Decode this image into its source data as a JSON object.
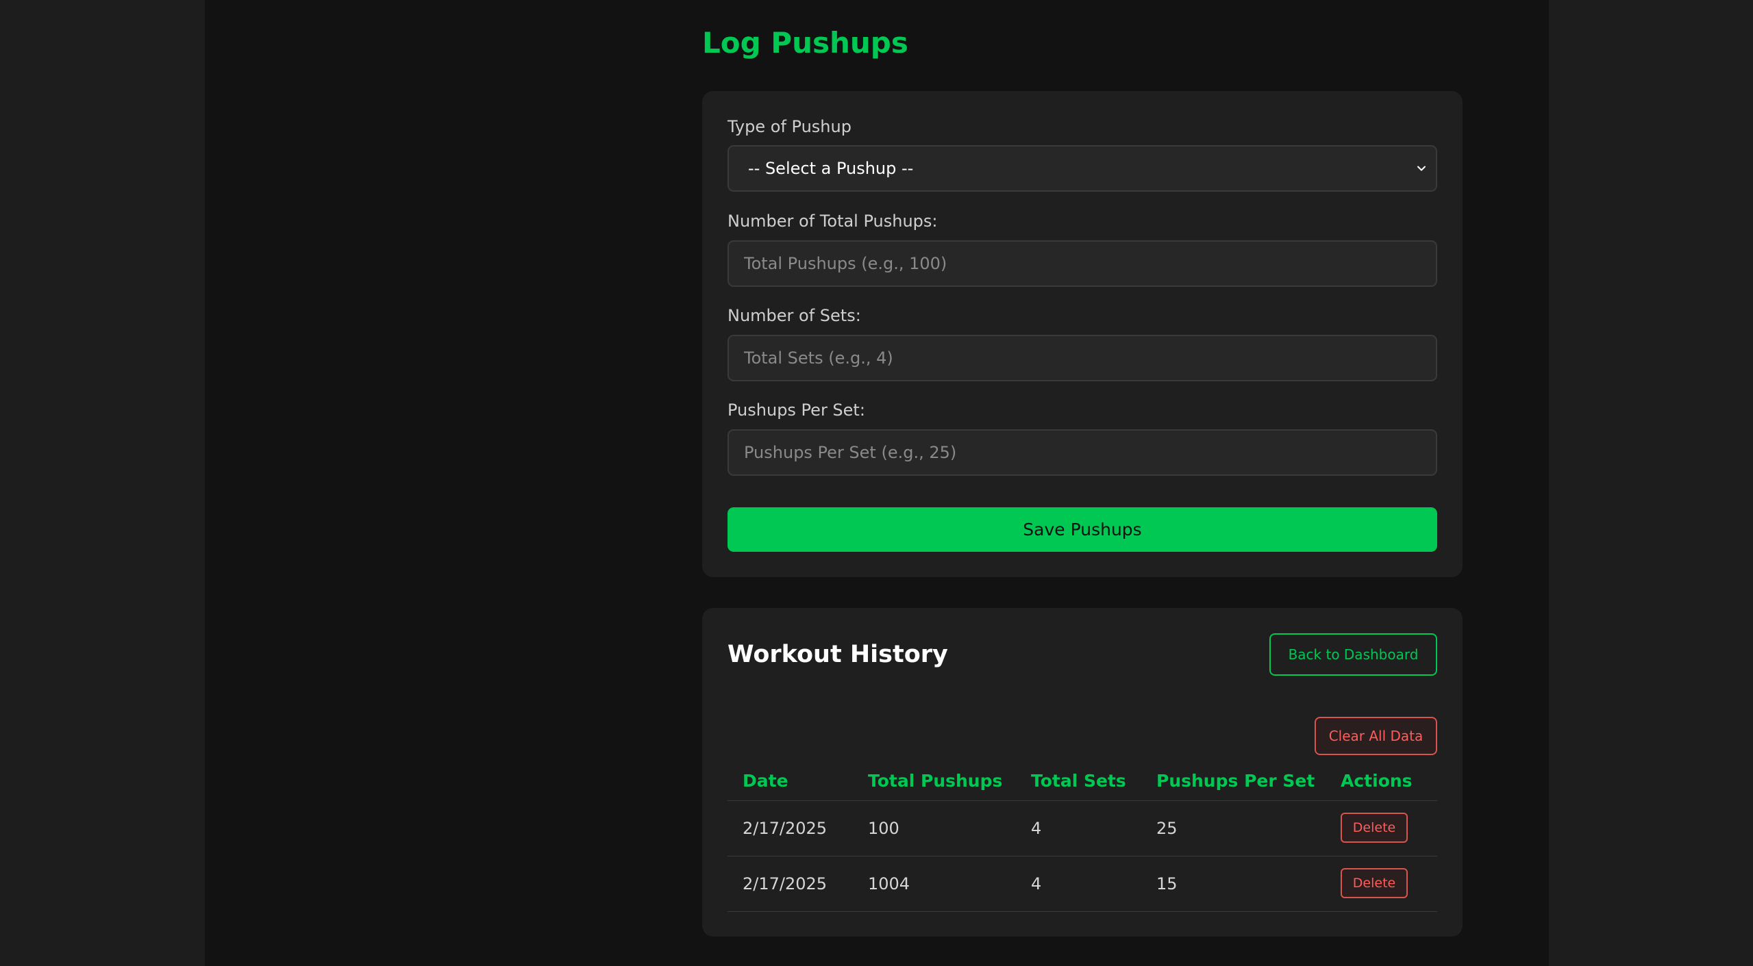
{
  "page": {
    "title": "Log Pushups"
  },
  "form": {
    "type_label": "Type of Pushup",
    "type_select_value": "-- Select a Pushup --",
    "total_label": "Number of Total Pushups:",
    "total_placeholder": "Total Pushups (e.g., 100)",
    "total_value": "",
    "sets_label": "Number of Sets:",
    "sets_placeholder": "Total Sets (e.g., 4)",
    "sets_value": "",
    "per_set_label": "Pushups Per Set:",
    "per_set_placeholder": "Pushups Per Set (e.g., 25)",
    "per_set_value": "",
    "save_label": "Save Pushups"
  },
  "history": {
    "title": "Workout History",
    "back_label": "Back to Dashboard",
    "clear_label": "Clear All Data",
    "columns": [
      "Date",
      "Total Pushups",
      "Total Sets",
      "Pushups Per Set",
      "Actions"
    ],
    "rows": [
      {
        "date": "2/17/2025",
        "total": "100",
        "sets": "4",
        "per_set": "25",
        "action": "Delete"
      },
      {
        "date": "2/17/2025",
        "total": "1004",
        "sets": "4",
        "per_set": "15",
        "action": "Delete"
      }
    ]
  },
  "colors": {
    "accent": "#00c853",
    "danger": "#ff5c5c",
    "background": "#121212",
    "card": "#1f1f1f"
  },
  "icons": {
    "select_chevron": "chevron-down-icon"
  }
}
